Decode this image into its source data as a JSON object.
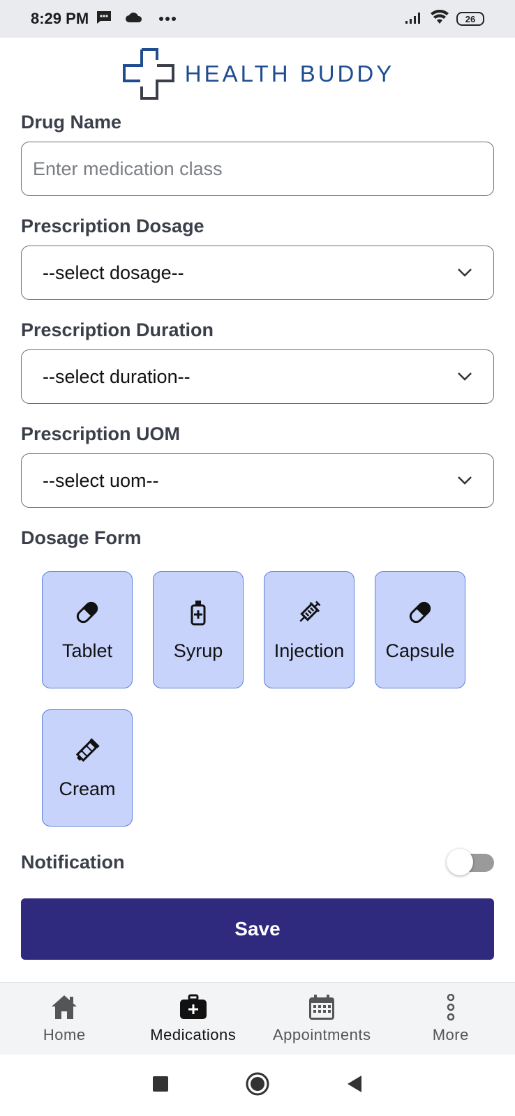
{
  "status_bar": {
    "time": "8:29 PM",
    "battery": "26",
    "icons": [
      "message-icon",
      "cloud-icon",
      "more-dots-icon",
      "signal-icon",
      "wifi-icon",
      "battery-icon"
    ]
  },
  "header": {
    "logo_text": "HEALTH BUDDY"
  },
  "form": {
    "drug_name": {
      "label": "Drug Name",
      "placeholder": "Enter medication class"
    },
    "dosage": {
      "label": "Prescription Dosage",
      "value": "--select dosage--"
    },
    "duration": {
      "label": "Prescription Duration",
      "value": "--select duration--"
    },
    "uom": {
      "label": "Prescription UOM",
      "value": "--select uom--"
    },
    "dosage_form": {
      "label": "Dosage Form",
      "options": [
        {
          "label": "Tablet",
          "icon": "pill-icon"
        },
        {
          "label": "Syrup",
          "icon": "bottle-icon"
        },
        {
          "label": "Injection",
          "icon": "syringe-icon"
        },
        {
          "label": "Capsule",
          "icon": "pill-icon"
        },
        {
          "label": "Cream",
          "icon": "tube-icon"
        }
      ]
    },
    "notification": {
      "label": "Notification",
      "enabled": false
    },
    "save_label": "Save"
  },
  "bottom_nav": {
    "items": [
      {
        "label": "Home",
        "icon": "home-icon"
      },
      {
        "label": "Medications",
        "icon": "medical-kit-icon",
        "active": true
      },
      {
        "label": "Appointments",
        "icon": "calendar-icon"
      },
      {
        "label": "More",
        "icon": "more-vertical-icon"
      }
    ]
  },
  "colors": {
    "accent": "#302a7e",
    "card_bg": "#c8d3fb",
    "card_border": "#5b7fd8",
    "logo": "#1f4d8f"
  }
}
